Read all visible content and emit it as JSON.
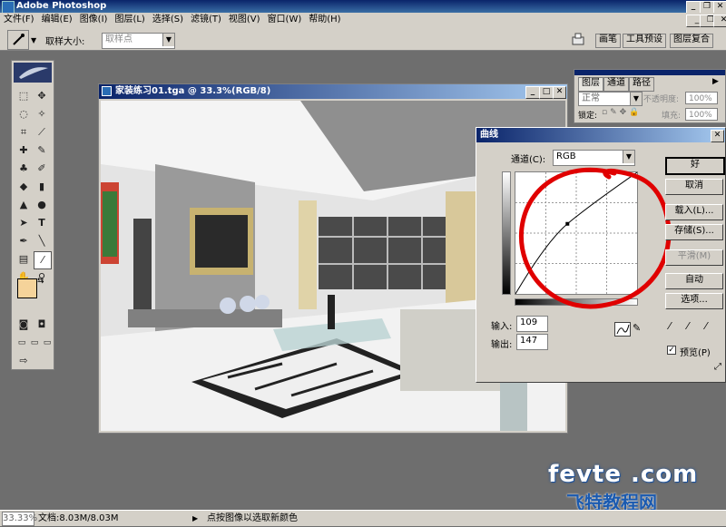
{
  "app": {
    "title": "Adobe Photoshop"
  },
  "menu": [
    "文件(F)",
    "编辑(E)",
    "图像(I)",
    "图层(L)",
    "选择(S)",
    "滤镜(T)",
    "视图(V)",
    "窗口(W)",
    "帮助(H)"
  ],
  "options": {
    "sample_size_label": "取样大小:",
    "sample_size_value": "取样点"
  },
  "palette_tabs": [
    "画笔",
    "工具预设",
    "图层复合"
  ],
  "document": {
    "title": "家装练习01.tga @ 33.3%(RGB/8)"
  },
  "layers": {
    "tabs": [
      "图层",
      "通道",
      "路径"
    ],
    "blend_mode": "正常",
    "opacity_label": "不透明度:",
    "opacity_value": "100%",
    "lock_label": "锁定:",
    "fill_label": "填充:",
    "fill_value": "100%"
  },
  "curves": {
    "title": "曲线",
    "channel_label": "通道(C):",
    "channel_value": "RGB",
    "buttons": {
      "ok": "好",
      "cancel": "取消",
      "load": "载入(L)...",
      "save": "存储(S)...",
      "smooth": "平滑(M)",
      "auto": "自动",
      "options": "选项..."
    },
    "input_label": "输入:",
    "input_value": "109",
    "output_label": "输出:",
    "output_value": "147",
    "preview_label": "预览(P)",
    "preview_checked": true,
    "highlight_color": "#e00000"
  },
  "status": {
    "zoom": "33.33%",
    "doc_size": "文档:8.03M/8.03M",
    "hint": "点按图像以选取新颜色"
  },
  "watermark": {
    "site": "fevte .com",
    "sub": "飞特教程网"
  },
  "colors": {
    "foreground": "#f5d39a",
    "background": "#ffffff",
    "workspace": "#6e6e6e",
    "titlebar": "#0a246a"
  }
}
